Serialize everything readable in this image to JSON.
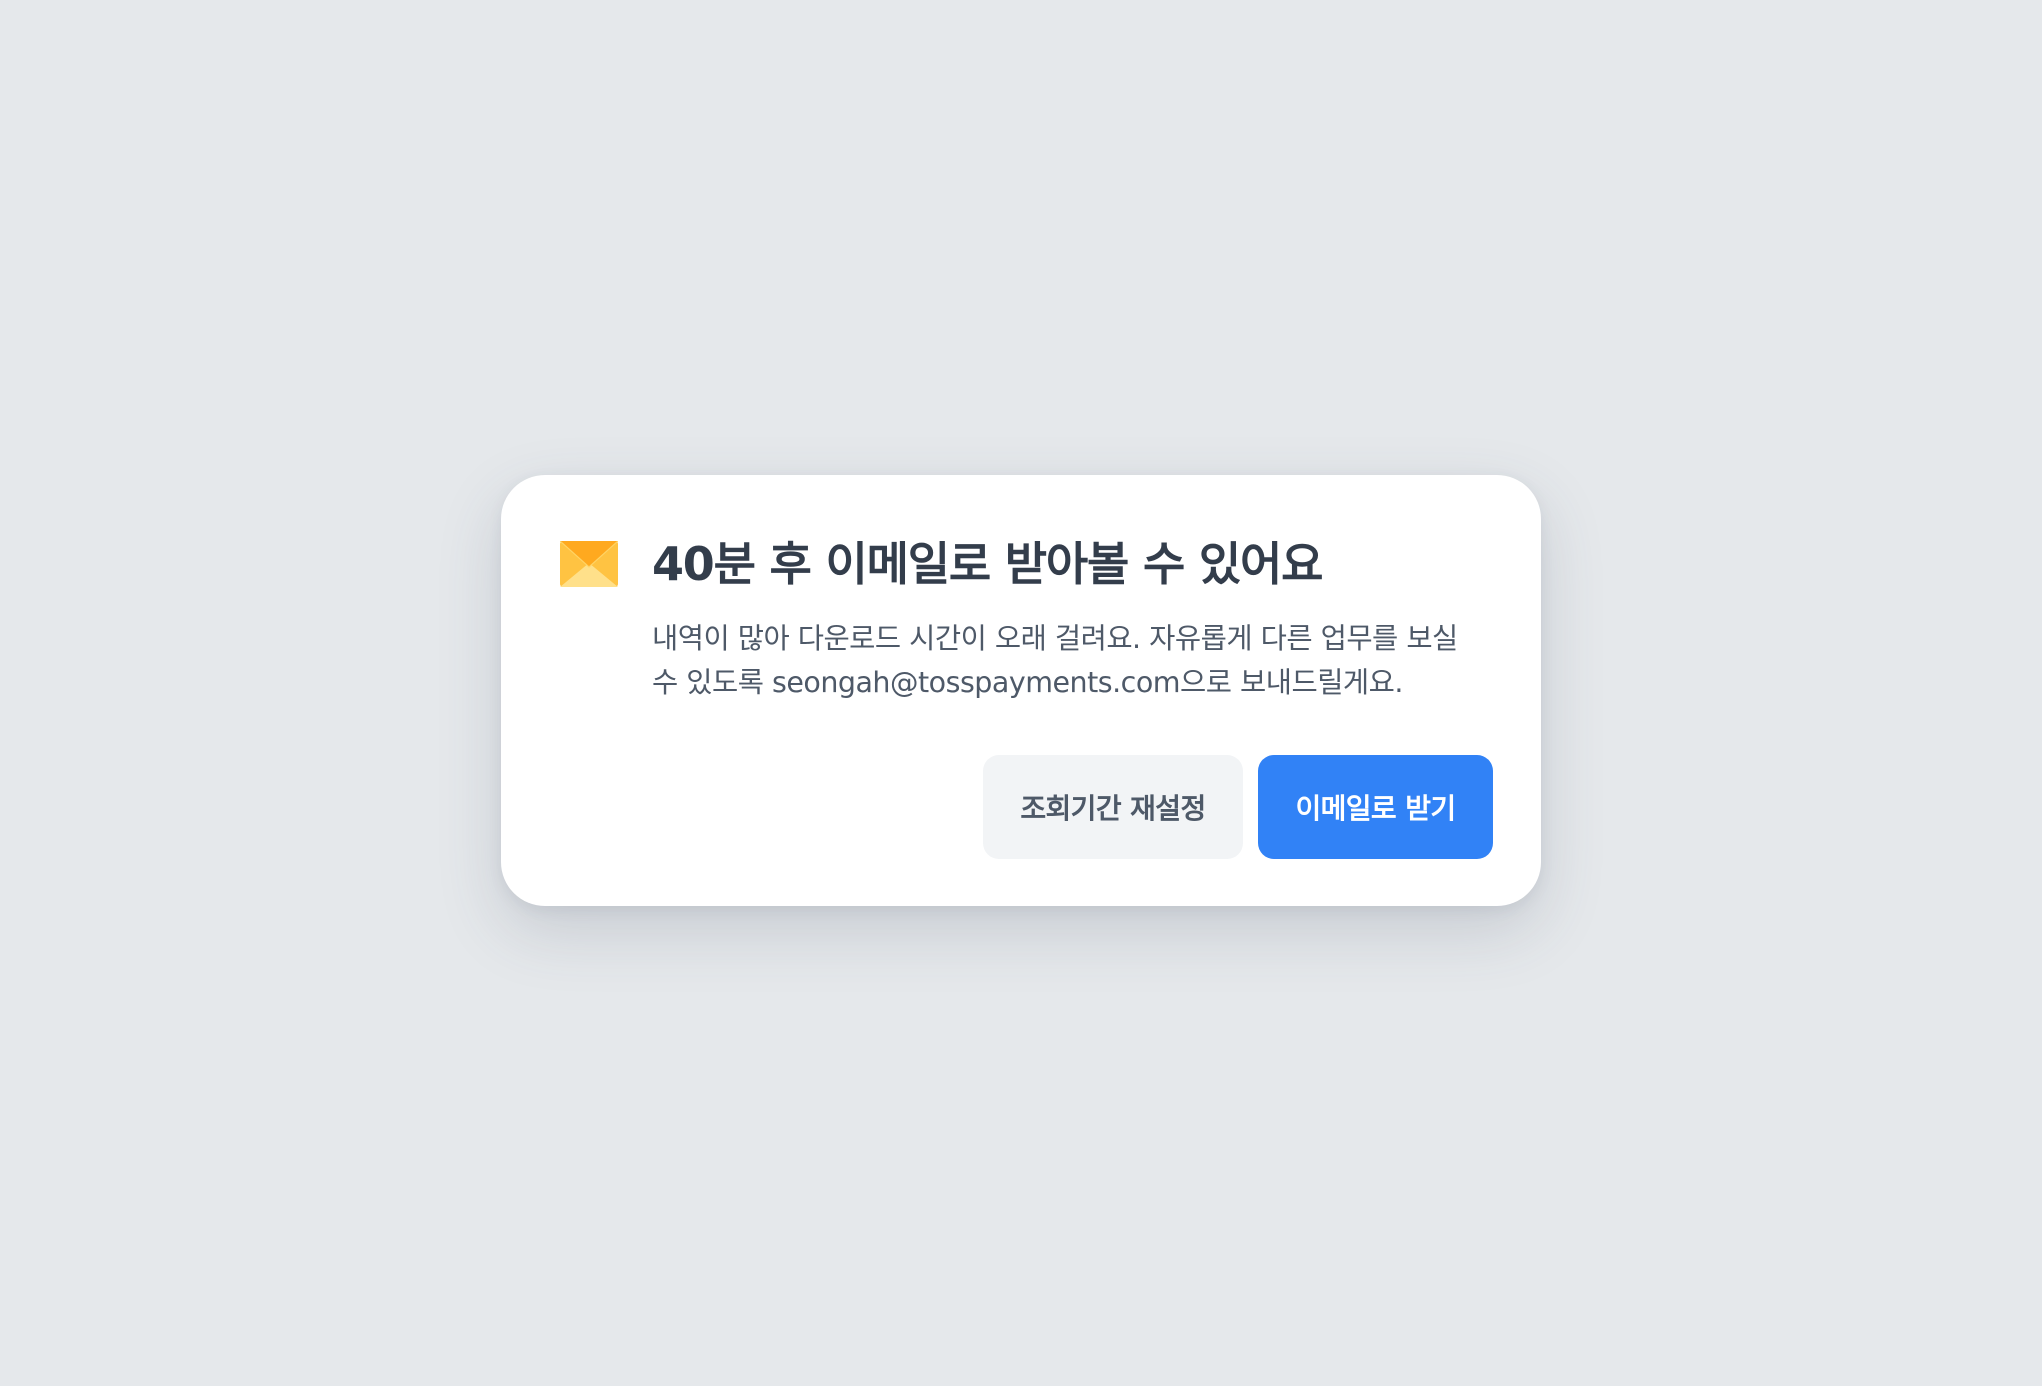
{
  "dialog": {
    "icon": "envelope-icon",
    "title": "40분 후 이메일로 받아볼 수 있어요",
    "description_line1": "내역이 많아 다운로드 시간이 오래 걸려요. 자유롭게 다른 업무를 보실",
    "description_line2": "수 있도록 seongah@tosspayments.com으로 보내드릴게요.",
    "secondary_button_label": "조회기간 재설정",
    "primary_button_label": "이메일로 받기"
  },
  "colors": {
    "background": "#e5e8eb",
    "dialog": "#ffffff",
    "title": "#333d4b",
    "description": "#4e5968",
    "secondary_button": "#f2f4f6",
    "primary_button": "#3182f6",
    "envelope": "#ffc342"
  }
}
